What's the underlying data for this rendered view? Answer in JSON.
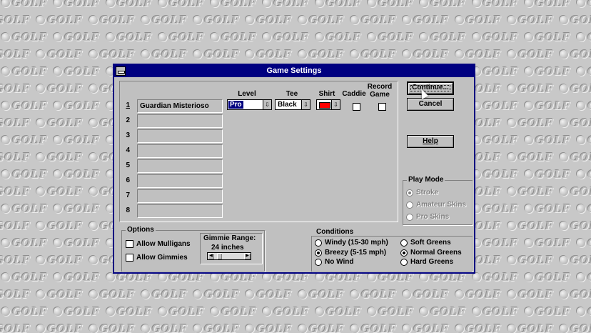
{
  "background": {
    "tile_text": "GOLF",
    "color": "#c8c8c8"
  },
  "dialog": {
    "title": "Game Settings",
    "columns": {
      "level": "Level",
      "tee": "Tee",
      "shirt": "Shirt",
      "caddie": "Caddie",
      "record_game": "Record Game"
    },
    "players": [
      {
        "number": "1",
        "name": "Guardian Misterioso",
        "level": "Pro",
        "tee": "Black",
        "shirt_color": "#ff0000",
        "caddie": false,
        "record_game": false
      },
      {
        "number": "2",
        "name": ""
      },
      {
        "number": "3",
        "name": ""
      },
      {
        "number": "4",
        "name": ""
      },
      {
        "number": "5",
        "name": ""
      },
      {
        "number": "6",
        "name": ""
      },
      {
        "number": "7",
        "name": ""
      },
      {
        "number": "8",
        "name": ""
      }
    ],
    "buttons": {
      "continue": "Continue...",
      "cancel": "Cancel",
      "help": "Help"
    },
    "play_mode": {
      "label": "Play Mode",
      "options": [
        {
          "label": "Stroke",
          "selected": true,
          "enabled": false
        },
        {
          "label": "Amateur Skins",
          "selected": false,
          "enabled": false
        },
        {
          "label": "Pro Skins",
          "selected": false,
          "enabled": false
        }
      ]
    },
    "options": {
      "label": "Options",
      "allow_mulligans": "Allow Mulligans",
      "allow_gimmies": "Allow Gimmies",
      "gimmie_range_label": "Gimmie Range:",
      "gimmie_range_value": "24 inches",
      "gimmie_range_fraction": 0.12
    },
    "conditions": {
      "label": "Conditions",
      "wind": [
        {
          "label": "Windy (15-30 mph)",
          "selected": false
        },
        {
          "label": "Breezy (5-15 mph)",
          "selected": true
        },
        {
          "label": "No Wind",
          "selected": false
        }
      ],
      "greens": [
        {
          "label": "Soft Greens",
          "selected": false
        },
        {
          "label": "Normal Greens",
          "selected": true
        },
        {
          "label": "Hard Greens",
          "selected": false
        }
      ]
    }
  }
}
